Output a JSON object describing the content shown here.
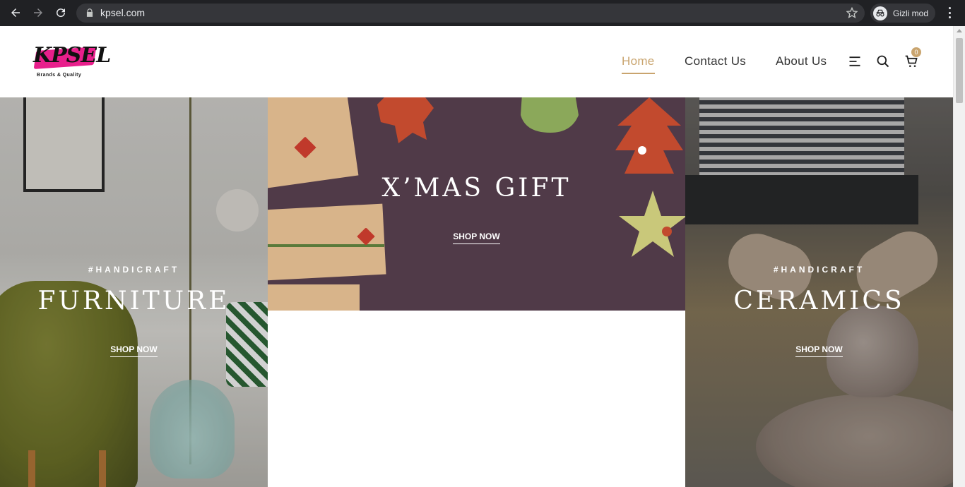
{
  "browser": {
    "url": "kpsel.com",
    "incognito_label": "Gizli mod"
  },
  "site": {
    "logo_text": "KPSEL",
    "logo_tagline": "Brands & Quality",
    "nav": [
      {
        "label": "Home",
        "active": true
      },
      {
        "label": "Contact Us",
        "active": false
      },
      {
        "label": "About Us",
        "active": false
      }
    ],
    "icons": [
      "menu-lines-icon",
      "search-icon",
      "cart-icon"
    ],
    "cart_count": "0",
    "accent_color": "#c9a46e"
  },
  "banners": {
    "furniture": {
      "hashtag": "#HANDICRAFT",
      "title": "FURNITURE",
      "cta": "SHOP NOW"
    },
    "xmas": {
      "title": "X’MAS GIFT",
      "cta": "SHOP NOW"
    },
    "ceramics": {
      "hashtag": "#HANDICRAFT",
      "title": "CERAMICS",
      "cta": "SHOP NOW"
    }
  }
}
